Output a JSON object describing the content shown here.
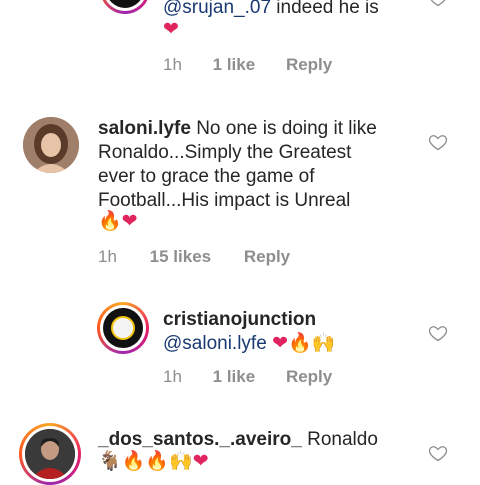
{
  "comments": [
    {
      "id": "reply-top",
      "mention": "@srujan_.07",
      "text": " indeed he is",
      "emoji": [
        "heart"
      ],
      "time": "1h",
      "likes": "1 like",
      "reply": "Reply"
    },
    {
      "id": "saloni",
      "username": "saloni.lyfe",
      "text_lines": [
        " No one is doing it like",
        "Ronaldo...Simply the Greatest",
        "ever to grace the game of",
        "Football...His impact is Unreal"
      ],
      "emoji": [
        "fire",
        "heart"
      ],
      "time": "1h",
      "likes": "15 likes",
      "reply": "Reply"
    },
    {
      "id": "cristiano-reply",
      "username": "cristianojunction",
      "mention": "@saloni.lyfe",
      "emoji": [
        "heart",
        "fire",
        "raised-hands"
      ],
      "time": "1h",
      "likes": "1 like",
      "reply": "Reply"
    },
    {
      "id": "dos-santos",
      "username": "_dos_santos._.aveiro_",
      "text": " Ronaldo",
      "emoji": [
        "goat",
        "fire",
        "fire",
        "raised-hands",
        "heart"
      ]
    }
  ],
  "colors": {
    "username": "#262626",
    "mention": "#1a3a73",
    "meta": "#8e8e8e",
    "heart_emoji": "#e0245e",
    "fire_emoji": "#ff7a00"
  }
}
